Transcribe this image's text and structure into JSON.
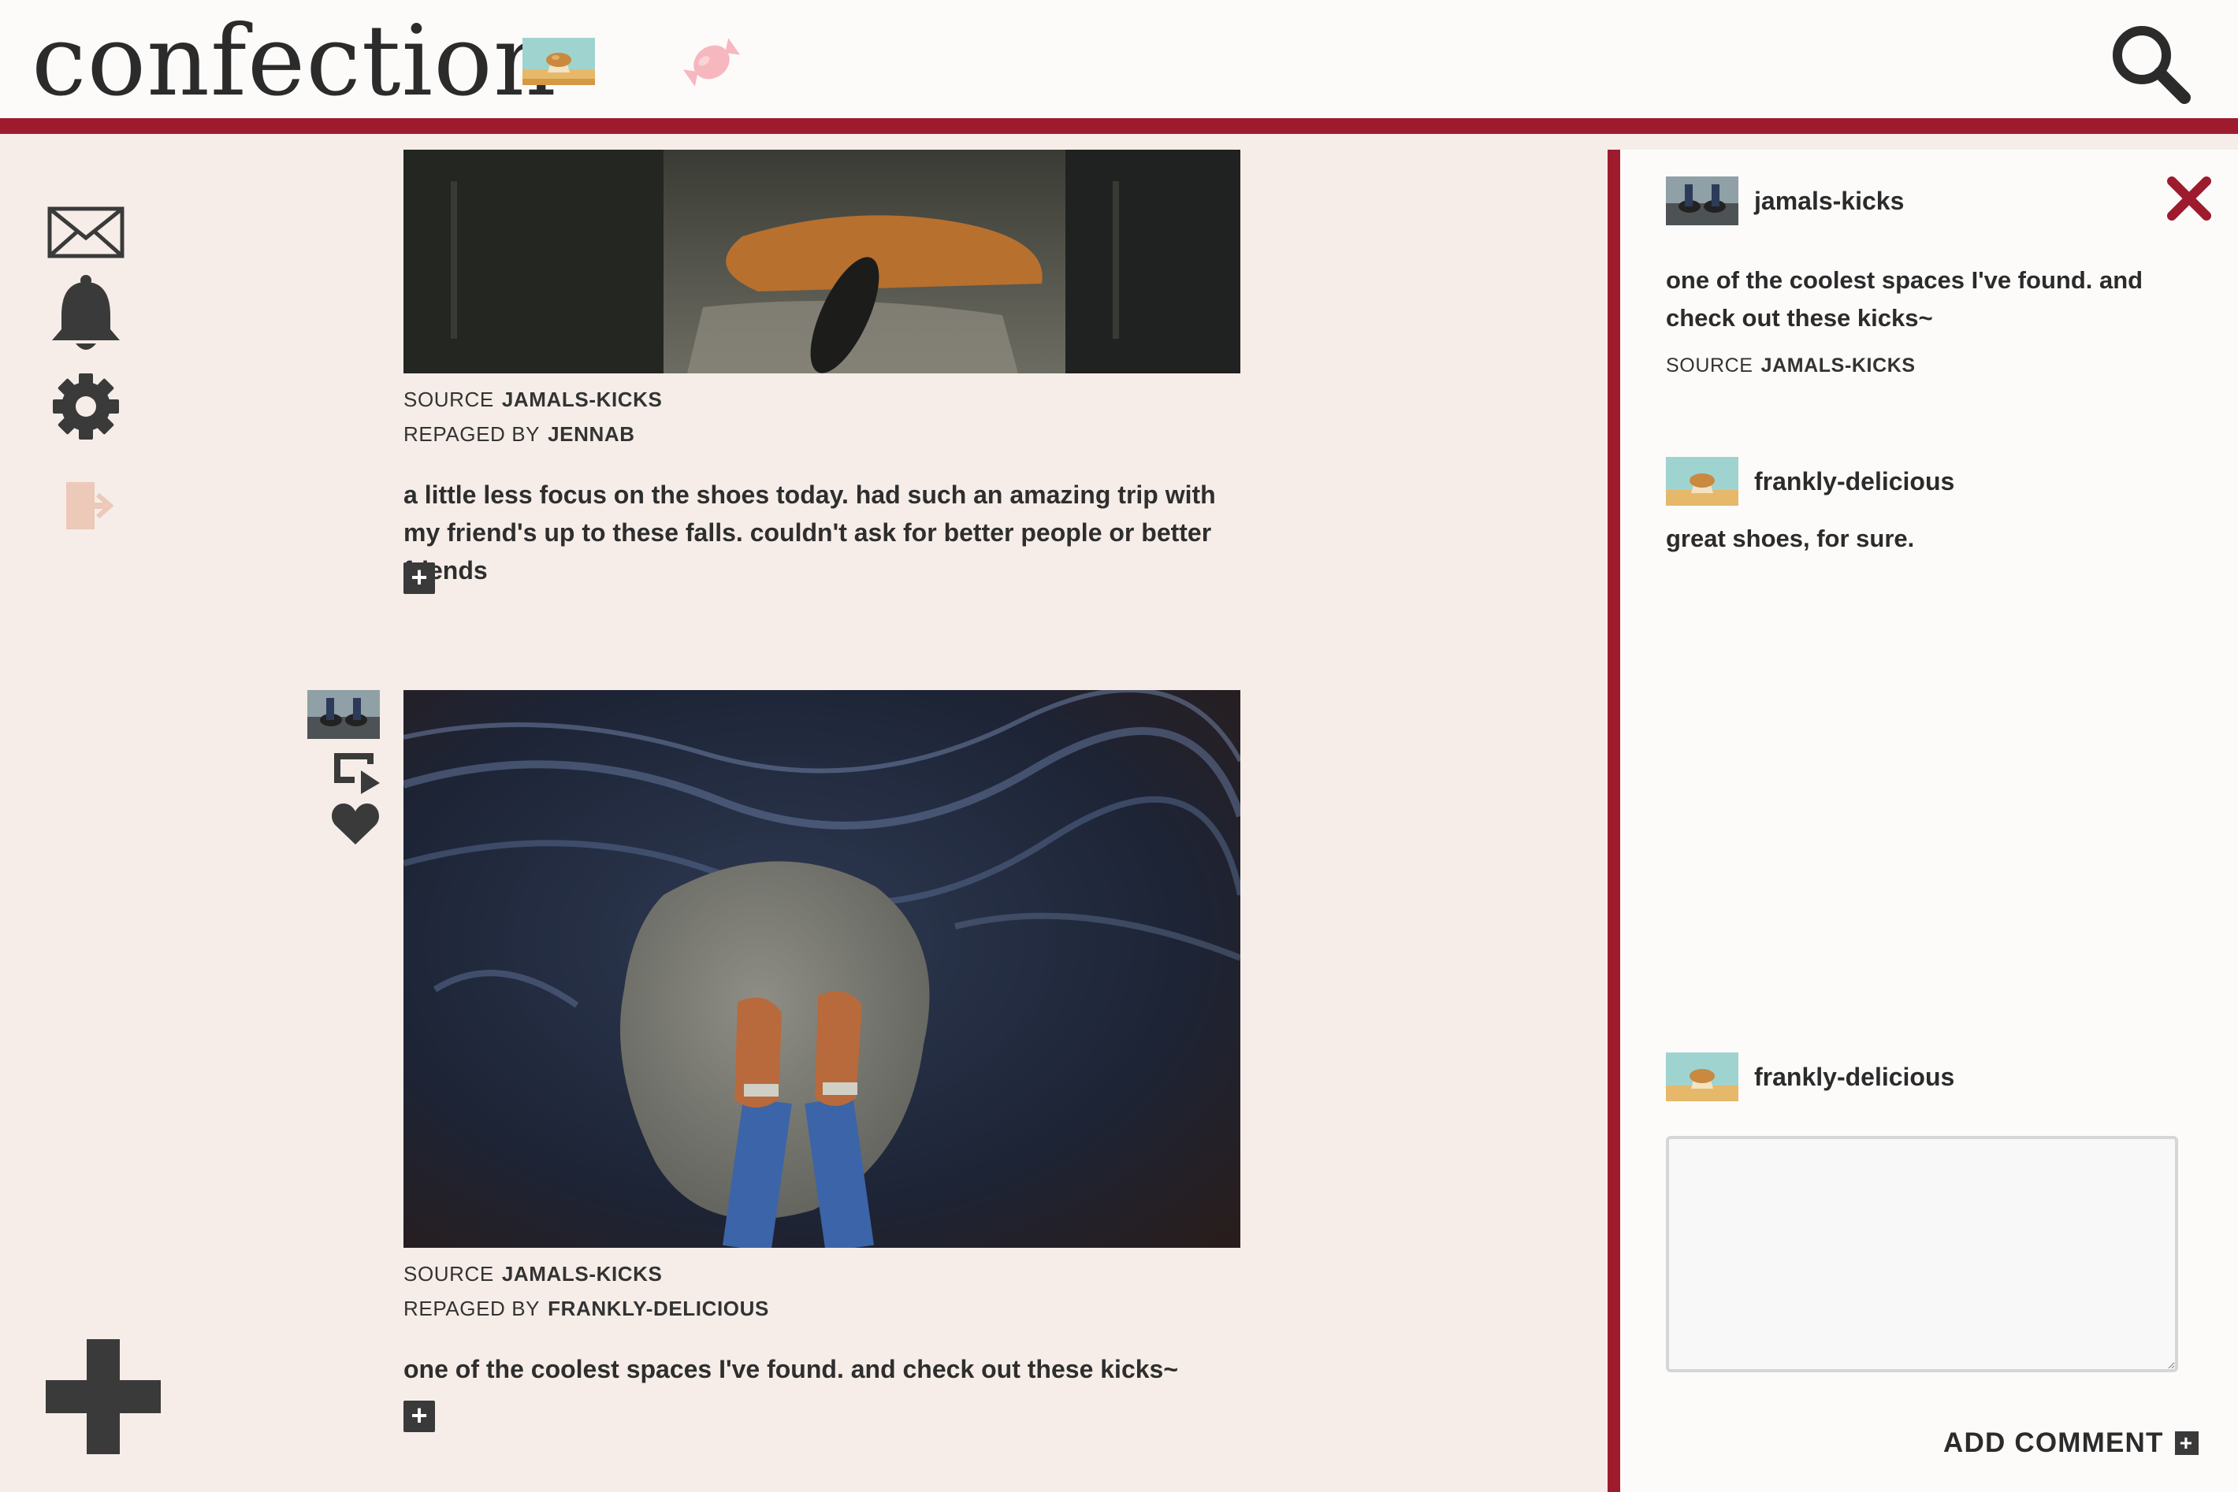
{
  "header": {
    "brand": "confection",
    "icons": [
      "muffin-thumbnail",
      "candy-icon",
      "search-icon"
    ]
  },
  "nav": {
    "icons": [
      "mail-icon",
      "bell-icon",
      "gear-icon",
      "logout-icon",
      "plus-icon"
    ]
  },
  "feed": {
    "posts": [
      {
        "source_label": "SOURCE",
        "source": "JAMALS-KICKS",
        "repaged_label": "REPAGED BY",
        "repaged_by": "JENNAB",
        "caption": "a little less focus on the shoes today. had such an amazing trip with my friend's up to these falls. couldn't ask for better people or better friends",
        "expand": "+"
      },
      {
        "source_label": "SOURCE",
        "source": "JAMALS-KICKS",
        "repaged_label": "REPAGED BY",
        "repaged_by": "FRANKLY-DELICIOUS",
        "caption": "one of the coolest spaces I've found. and check out these kicks~",
        "expand": "+"
      }
    ]
  },
  "panel": {
    "post": {
      "username": "jamals-kicks",
      "text": "one of the coolest spaces I've found. and check out these kicks~",
      "source_label": "SOURCE",
      "source": "JAMALS-KICKS"
    },
    "comments": [
      {
        "username": "frankly-delicious",
        "text": "great shoes, for sure."
      }
    ],
    "composer": {
      "username": "frankly-delicious",
      "value": "",
      "submit_label": "ADD COMMENT"
    }
  },
  "colors": {
    "accent": "#9e1b2e",
    "background": "#f6ede8",
    "panel": "#fcfbfa",
    "icon": "#3a3a3a"
  }
}
